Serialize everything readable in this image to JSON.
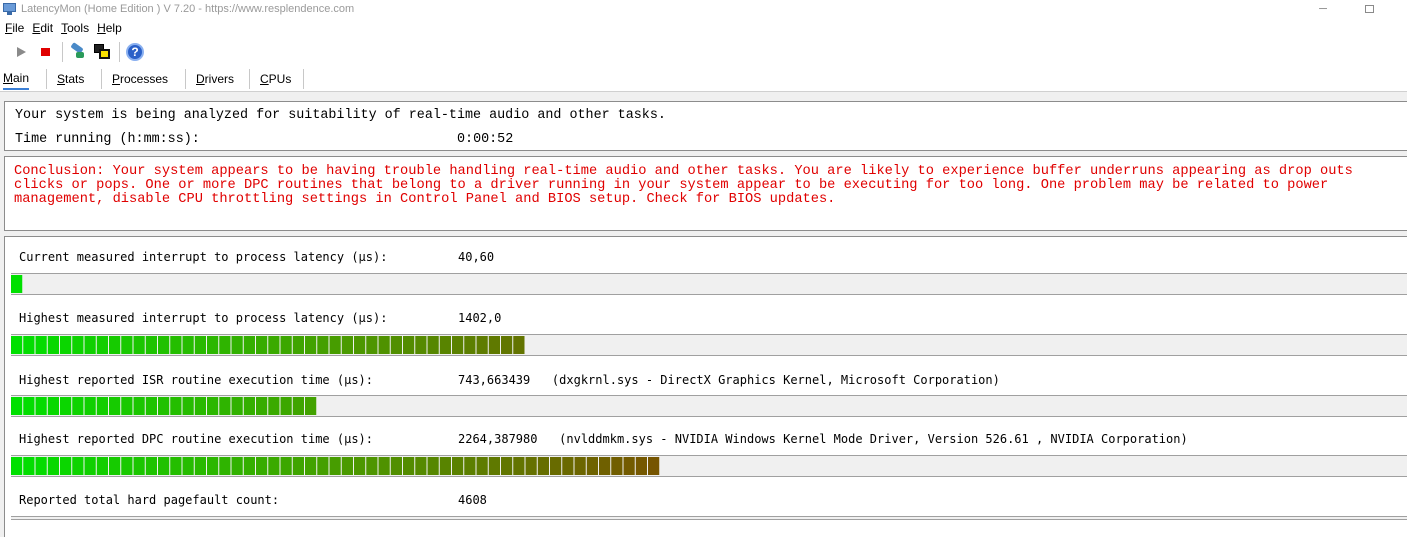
{
  "window": {
    "title": "LatencyMon  (Home Edition )  V 7.20 - https://www.resplendence.com",
    "minimize_glyph": "─"
  },
  "menu": [
    {
      "label": "File",
      "accel": "F",
      "rest": "ile"
    },
    {
      "label": "Edit",
      "accel": "E",
      "rest": "dit"
    },
    {
      "label": "Tools",
      "accel": "T",
      "rest": "ools"
    },
    {
      "label": "Help",
      "accel": "H",
      "rest": "elp"
    }
  ],
  "toolbar": {
    "help_glyph": "?"
  },
  "tabs": [
    {
      "label": "Main",
      "accel": "M",
      "rest": "ain",
      "active": true
    },
    {
      "label": "Stats",
      "accel": "S",
      "rest": "tats",
      "active": false
    },
    {
      "label": "Processes",
      "accel": "P",
      "rest": "rocesses",
      "active": false
    },
    {
      "label": "Drivers",
      "accel": "D",
      "rest": "rivers",
      "active": false
    },
    {
      "label": "CPUs",
      "accel": "C",
      "rest": "PUs",
      "active": false
    }
  ],
  "status": {
    "analyzing_text": "Your system is being analyzed for suitability of real-time audio and other tasks.",
    "time_label": "Time running (h:mm:ss):",
    "time_value": "0:00:52"
  },
  "conclusion": {
    "line1": "Conclusion: Your system appears to be having trouble handling real-time audio and other tasks. You are likely to experience buffer underruns appearing as drop outs",
    "line2": "clicks or pops. One or more DPC routines that belong to a driver running in your system appear to be executing for too long. One problem may be related to power",
    "line3": "management, disable CPU throttling settings in Control Panel and BIOS setup. Check for BIOS updates.",
    "color": "#e00000"
  },
  "measurements": [
    {
      "label": "Current measured interrupt to process latency (µs):",
      "value": "40,60",
      "lit_segments": 1
    },
    {
      "label": "Highest measured interrupt to process latency (µs):",
      "value": "1402,0",
      "lit_segments": 42
    },
    {
      "label": "Highest reported ISR routine execution time (µs):",
      "value": "743,663439   (dxgkrnl.sys - DirectX Graphics Kernel, Microsoft Corporation)",
      "lit_segments": 25
    },
    {
      "label": "Highest reported DPC routine execution time (µs):",
      "value": "2264,387980   (nvlddmkm.sys - NVIDIA Windows Kernel Mode Driver, Version 526.61 , NVIDIA Corporation)",
      "lit_segments": 53
    },
    {
      "label": "Reported total hard pagefault count:",
      "value": "4608",
      "lit_segments": 0
    }
  ],
  "meter_colors": {
    "start": "#00e000",
    "mid": "#4a9a00",
    "end": "#7a5000"
  }
}
